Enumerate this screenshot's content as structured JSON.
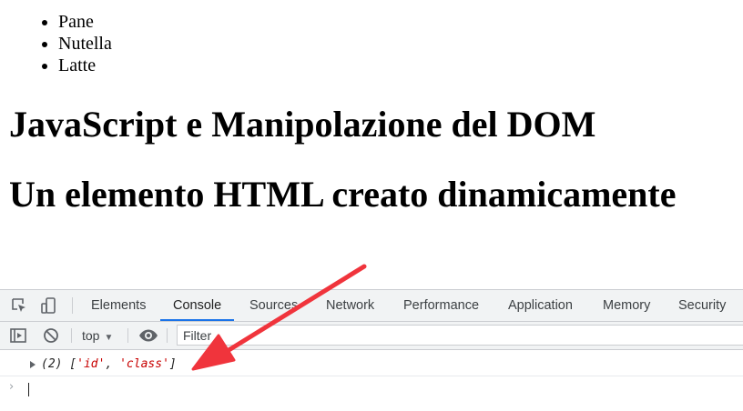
{
  "page": {
    "list_items": [
      "Pane",
      "Nutella",
      "Latte"
    ],
    "heading_1": "JavaScript e Manipolazione del DOM",
    "heading_2": "Un elemento HTML creato dinamicamente"
  },
  "devtools": {
    "tabs": [
      "Elements",
      "Console",
      "Sources",
      "Network",
      "Performance",
      "Application",
      "Memory",
      "Security"
    ],
    "active_tab": "Console",
    "context": "top",
    "filter_placeholder": "Filter",
    "log": {
      "prefix": "(2) [",
      "item_1": "'id'",
      "comma": ", ",
      "item_2": "'class'",
      "suffix": "]"
    },
    "prompt_symbol": "›"
  },
  "colors": {
    "accent": "#1a73e8",
    "console_string": "#c80000",
    "annotation_arrow": "#f0343c"
  },
  "icons": {
    "inspect": "inspect-element-icon",
    "device": "device-toolbar-icon",
    "sidebar": "console-sidebar-icon",
    "clear": "clear-console-icon",
    "eye": "live-expression-eye-icon"
  }
}
